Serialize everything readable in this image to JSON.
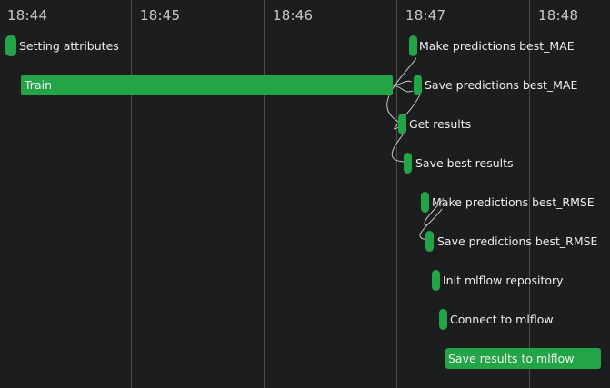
{
  "timeline": {
    "ticks": [
      "18:44",
      "18:45",
      "18:46",
      "18:47",
      "18:48"
    ]
  },
  "colors": {
    "background": "#1c1d1f",
    "bar": "#22a447",
    "grid": "#4a4b4e",
    "text": "#eeeeee"
  },
  "tasks": [
    {
      "label": "Setting attributes"
    },
    {
      "label": "Train"
    },
    {
      "label": "Make predictions best_MAE"
    },
    {
      "label": "Save predictions best_MAE"
    },
    {
      "label": "Get results"
    },
    {
      "label": "Save best results"
    },
    {
      "label": "Make predictions best_RMSE"
    },
    {
      "label": "Save predictions best_RMSE"
    },
    {
      "label": "Init mlflow repository"
    },
    {
      "label": "Connect to mlflow"
    },
    {
      "label": "Save results to mlflow"
    }
  ]
}
